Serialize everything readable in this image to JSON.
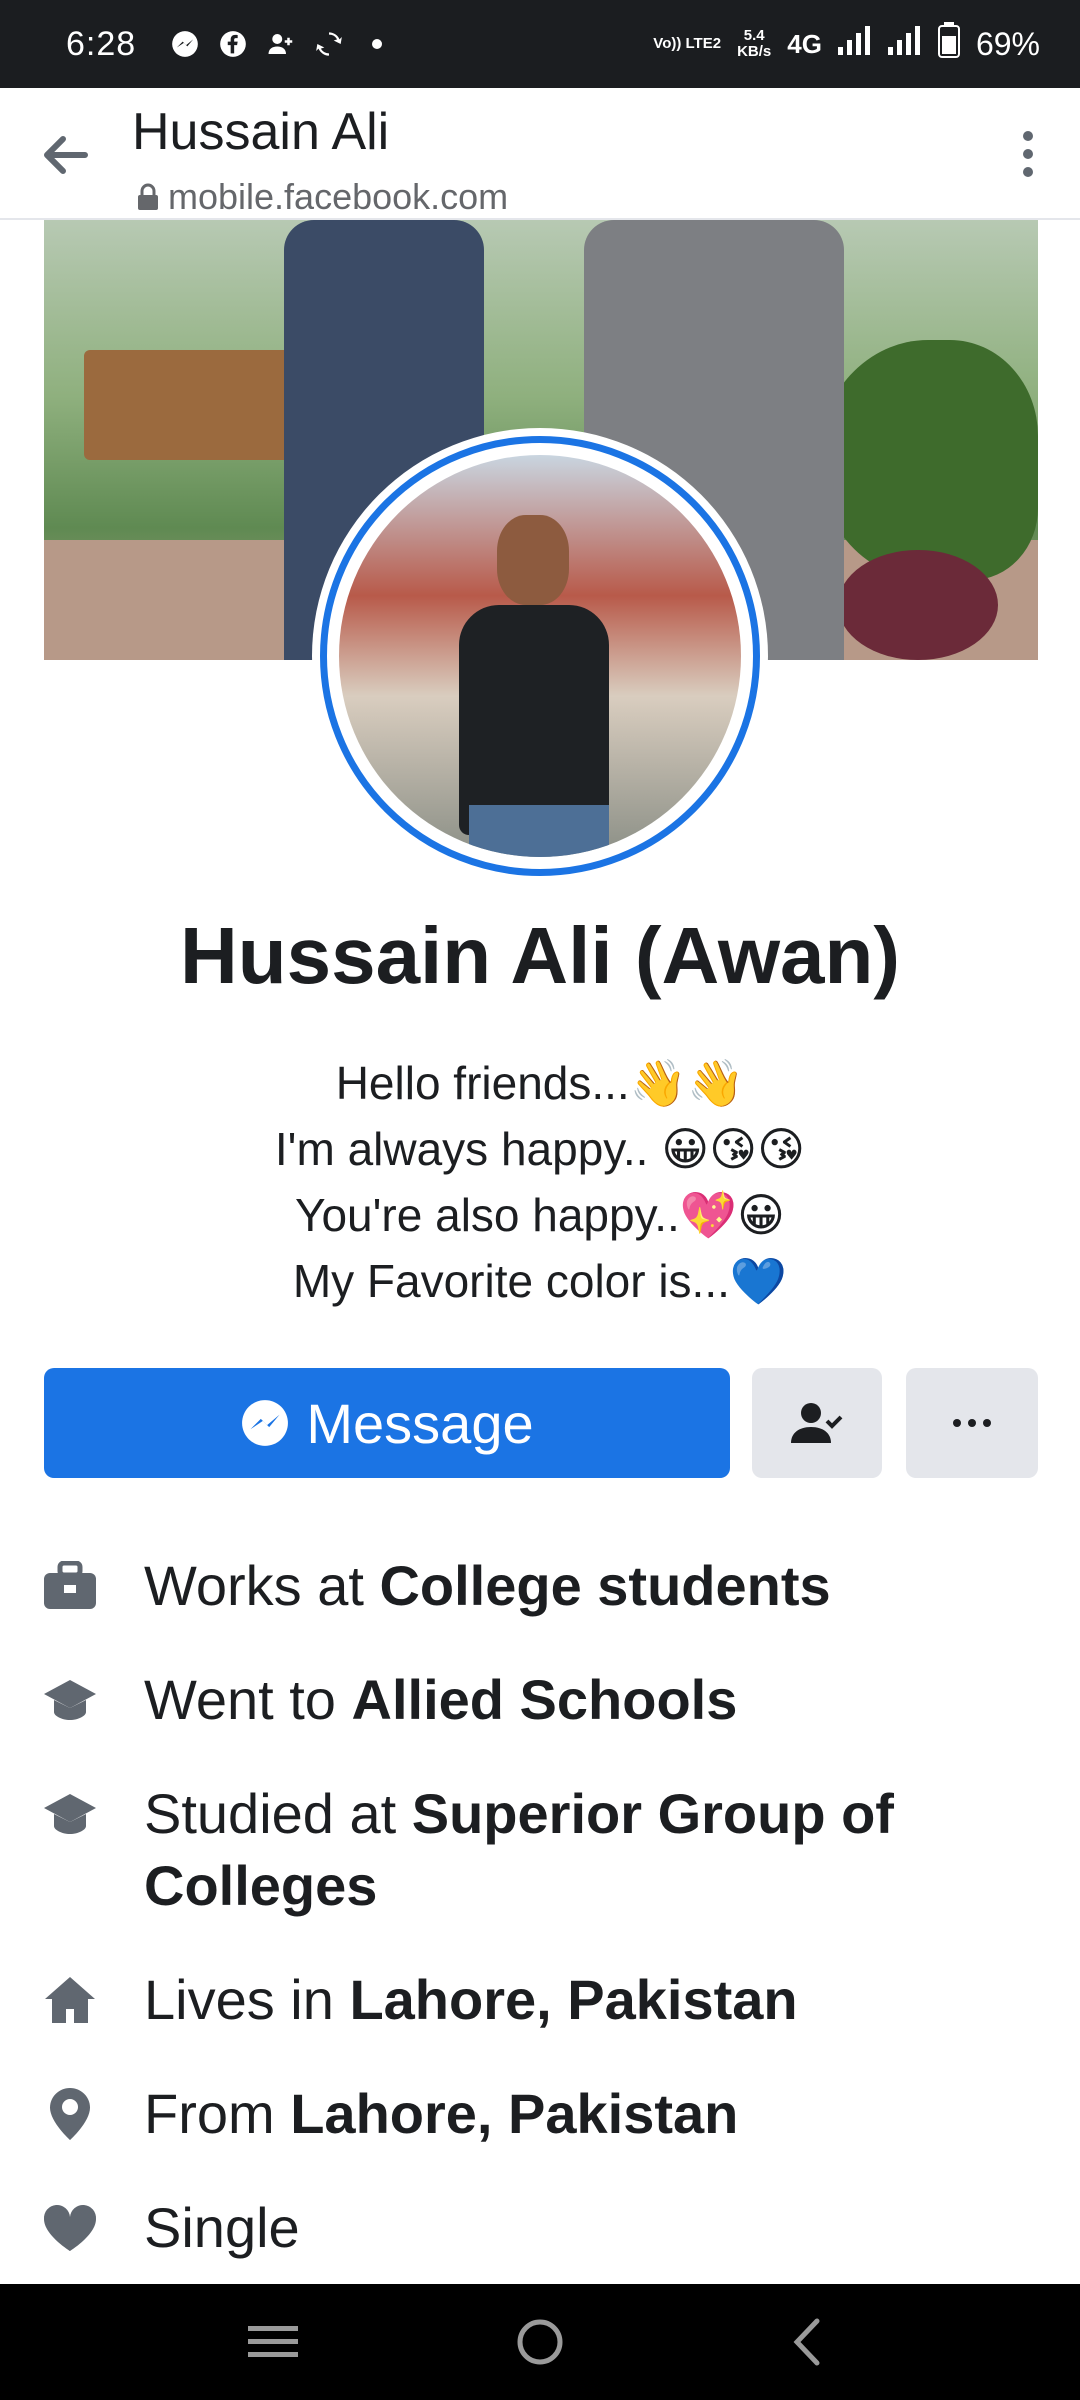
{
  "status_bar": {
    "time": "6:28",
    "net_top": "Vo)) LTE2",
    "speed_top": "5.4",
    "speed_bottom": "KB/s",
    "network": "4G",
    "battery": "69%"
  },
  "app_bar": {
    "title": "Hussain Ali",
    "url": "mobile.facebook.com"
  },
  "profile": {
    "name": "Hussain Ali (Awan)",
    "bio": [
      "Hello friends...👋👋",
      "I'm always happy.. 😀😘😘",
      "You're also happy..💖😀",
      "My Favorite color is...💙"
    ]
  },
  "actions": {
    "message_label": "Message"
  },
  "intro": [
    {
      "prefix": "Works at ",
      "value": "College students",
      "icon": "briefcase-icon"
    },
    {
      "prefix": "Went to ",
      "value": "Allied Schools",
      "icon": "graduation-cap-icon"
    },
    {
      "prefix": "Studied at ",
      "value": "Superior Group of Colleges",
      "icon": "graduation-cap-icon"
    },
    {
      "prefix": "Lives in ",
      "value": "Lahore, Pakistan",
      "icon": "home-icon"
    },
    {
      "prefix": "From ",
      "value": "Lahore, Pakistan",
      "icon": "location-pin-icon"
    },
    {
      "prefix": "Single",
      "value": "",
      "icon": "heart-icon"
    }
  ],
  "colors": {
    "accent": "#1b74e4",
    "status_bar_bg": "#1b1d20",
    "icon_gray": "#606770",
    "button_gray": "#e4e6eb"
  }
}
